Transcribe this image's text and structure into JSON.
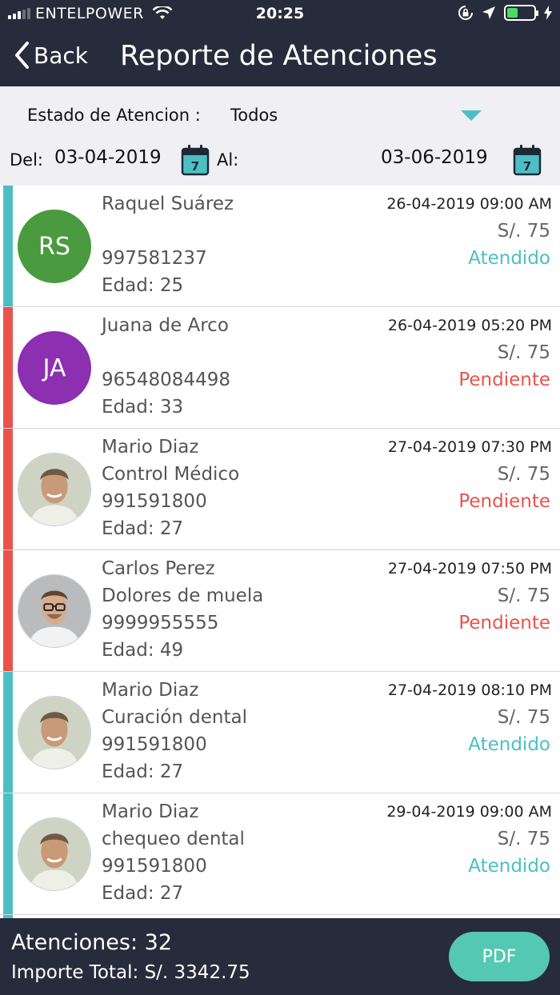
{
  "status_bar": {
    "carrier": "ENTELPOWER",
    "time": "20:25"
  },
  "nav": {
    "back_label": "Back",
    "title": "Reporte de Atenciones"
  },
  "filter": {
    "estado_label": "Estado de Atencion :",
    "estado_value": "Todos",
    "del_label": "Del:",
    "del_value": "03-04-2019",
    "al_label": "Al:",
    "al_value": "03-06-2019",
    "calendar_day": "7"
  },
  "colors": {
    "header_bg": "#262c3b",
    "atendido": "#4dbfc4",
    "pendiente": "#e9534c",
    "pdf_button": "#54c8b3"
  },
  "items": [
    {
      "name": "Raquel Suárez",
      "detail": "",
      "phone": "997581237",
      "age": "Edad: 25",
      "datetime": "26-04-2019 09:00 AM",
      "price": "S/. 75",
      "status": "Atendido",
      "initials": "RS",
      "avatar_color": "#4a9b3f"
    },
    {
      "name": "Juana de Arco",
      "detail": "",
      "phone": "96548084498",
      "age": "Edad: 33",
      "datetime": "26-04-2019 05:20 PM",
      "price": "S/. 75",
      "status": "Pendiente",
      "initials": "JA",
      "avatar_color": "#8c2fb0"
    },
    {
      "name": "Mario Diaz",
      "detail": "Control Médico",
      "phone": "991591800",
      "age": "Edad: 27",
      "datetime": "27-04-2019 07:30 PM",
      "price": "S/. 75",
      "status": "Pendiente",
      "avatar_icon": "man-photo-icon"
    },
    {
      "name": "Carlos Perez",
      "detail": "Dolores de muela",
      "phone": "9999955555",
      "age": "Edad: 49",
      "datetime": "27-04-2019 07:50 PM",
      "price": "S/. 75",
      "status": "Pendiente",
      "avatar_icon": "man-glasses-photo-icon"
    },
    {
      "name": "Mario Diaz",
      "detail": "Curación dental",
      "phone": "991591800",
      "age": "Edad: 27",
      "datetime": "27-04-2019 08:10 PM",
      "price": "S/. 75",
      "status": "Atendido",
      "avatar_icon": "man-photo-icon"
    },
    {
      "name": "Mario Diaz",
      "detail": "chequeo dental",
      "phone": "991591800",
      "age": "Edad: 27",
      "datetime": "29-04-2019 09:00 AM",
      "price": "S/. 75",
      "status": "Atendido",
      "avatar_icon": "man-photo-icon"
    }
  ],
  "footer": {
    "count": "Atenciones: 32",
    "total": "Importe Total: S/. 3342.75",
    "pdf_label": "PDF"
  }
}
